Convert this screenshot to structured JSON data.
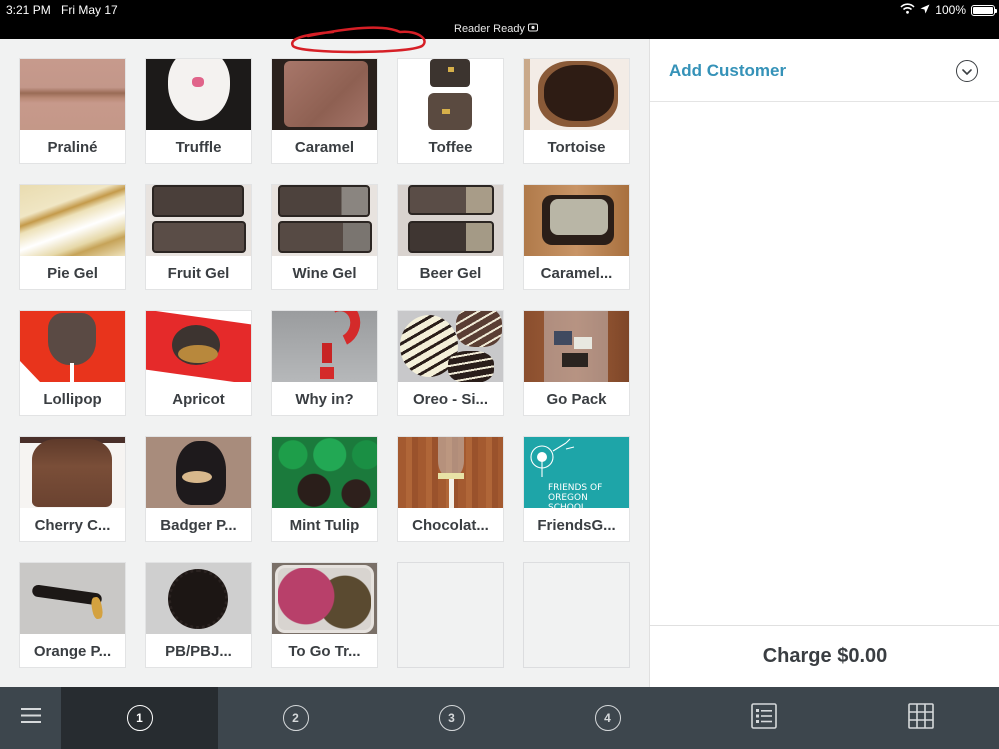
{
  "status_bar": {
    "time": "3:21 PM",
    "date": "Fri May 17",
    "reader_status": "Reader Ready",
    "battery_percent": "100%",
    "battery_level": 1.0,
    "icons": [
      "wifi-icon",
      "location-arrow-icon",
      "battery-icon",
      "card-reader-icon"
    ]
  },
  "grid": {
    "tiles": [
      {
        "label": "Praliné",
        "image": "praline"
      },
      {
        "label": "Truffle",
        "image": "truffle"
      },
      {
        "label": "Caramel",
        "image": "caramel"
      },
      {
        "label": "Toffee",
        "image": "toffee"
      },
      {
        "label": "Tortoise",
        "image": "tortoise"
      },
      {
        "label": "Pie Gel",
        "image": "pie-gel"
      },
      {
        "label": "Fruit Gel",
        "image": "fruit-gel"
      },
      {
        "label": "Wine Gel",
        "image": "wine-gel"
      },
      {
        "label": "Beer Gel",
        "image": "beer-gel"
      },
      {
        "label": "Caramel...",
        "image": "caramel-white"
      },
      {
        "label": "Lollipop",
        "image": "lollipop"
      },
      {
        "label": "Apricot",
        "image": "apricot"
      },
      {
        "label": "Why in?",
        "image": "question-mark"
      },
      {
        "label": "Oreo - Si...",
        "image": "oreo"
      },
      {
        "label": "Go Pack",
        "image": "go-pack"
      },
      {
        "label": "Cherry C...",
        "image": "cherry-cordial"
      },
      {
        "label": "Badger P...",
        "image": "badger"
      },
      {
        "label": "Mint Tulip",
        "image": "mint-tulip"
      },
      {
        "label": "Chocolat...",
        "image": "chocolate-pop"
      },
      {
        "label": "FriendsG...",
        "image": "friends-logo",
        "image_text": [
          "FRIENDS OF",
          "OREGON",
          "SCHOOL DISTRICT"
        ]
      },
      {
        "label": "Orange P...",
        "image": "orange-peel"
      },
      {
        "label": "PB/PBJ...",
        "image": "pb-cup"
      },
      {
        "label": "To Go Tr...",
        "image": "to-go-treats"
      },
      {
        "label": "",
        "image": "empty"
      },
      {
        "label": "",
        "image": "empty"
      }
    ]
  },
  "cart": {
    "add_customer": "Add Customer",
    "charge_label": "Charge $0.00"
  },
  "bottom_nav": {
    "menu_icon": "hamburger-icon",
    "pages": [
      {
        "label": "1",
        "active": true
      },
      {
        "label": "2",
        "active": false
      },
      {
        "label": "3",
        "active": false
      },
      {
        "label": "4",
        "active": false
      }
    ],
    "list_view_icon": "list-icon",
    "grid_view_icon": "grid-icon"
  },
  "colors": {
    "accent": "#3592b8",
    "nav_bg": "#3d464d",
    "nav_active_bg": "#272c30",
    "grid_bg": "#f1f2f2",
    "text": "#3a3e42"
  }
}
